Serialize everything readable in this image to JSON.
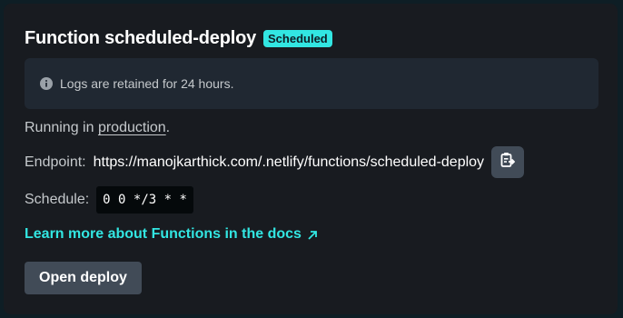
{
  "header": {
    "title": "Function scheduled-deploy",
    "status_badge": "Scheduled"
  },
  "notice": {
    "icon": "info-icon",
    "text": "Logs are retained for 24 hours."
  },
  "context": {
    "prefix": "Running in",
    "link": "production",
    "suffix": "."
  },
  "endpoint": {
    "label": "Endpoint:",
    "url": "https://manojkarthick.com/.netlify/functions/scheduled-deploy",
    "copy_icon": "clipboard-icon"
  },
  "schedule": {
    "label": "Schedule:",
    "cron": "0 0 */3 * *"
  },
  "docs": {
    "link_text": "Learn more about Functions in the docs",
    "icon": "external-arrow-icon"
  },
  "actions": {
    "open_deploy_label": "Open deploy"
  },
  "colors": {
    "accent": "#32e6e2",
    "background": "#181b20",
    "button": "#414b57"
  }
}
